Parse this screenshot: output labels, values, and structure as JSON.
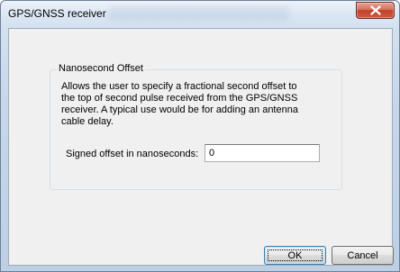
{
  "window": {
    "title": "GPS/GNSS receiver"
  },
  "titlebar": {
    "close_icon": "close-x-icon"
  },
  "group": {
    "legend": "Nanosecond Offset",
    "description": "Allows the user to specify a fractional second offset to\nthe top of second pulse received from the GPS/GNSS\nreceiver. A typical use would be for adding an antenna\ncable delay."
  },
  "offset": {
    "label": "Signed offset in nanoseconds:",
    "value": "0"
  },
  "buttons": {
    "ok_label": "OK",
    "cancel_label": "Cancel"
  },
  "colors": {
    "close_button": "#c2402a",
    "frame": "#bccfe5",
    "client": "#f0f0f0"
  }
}
